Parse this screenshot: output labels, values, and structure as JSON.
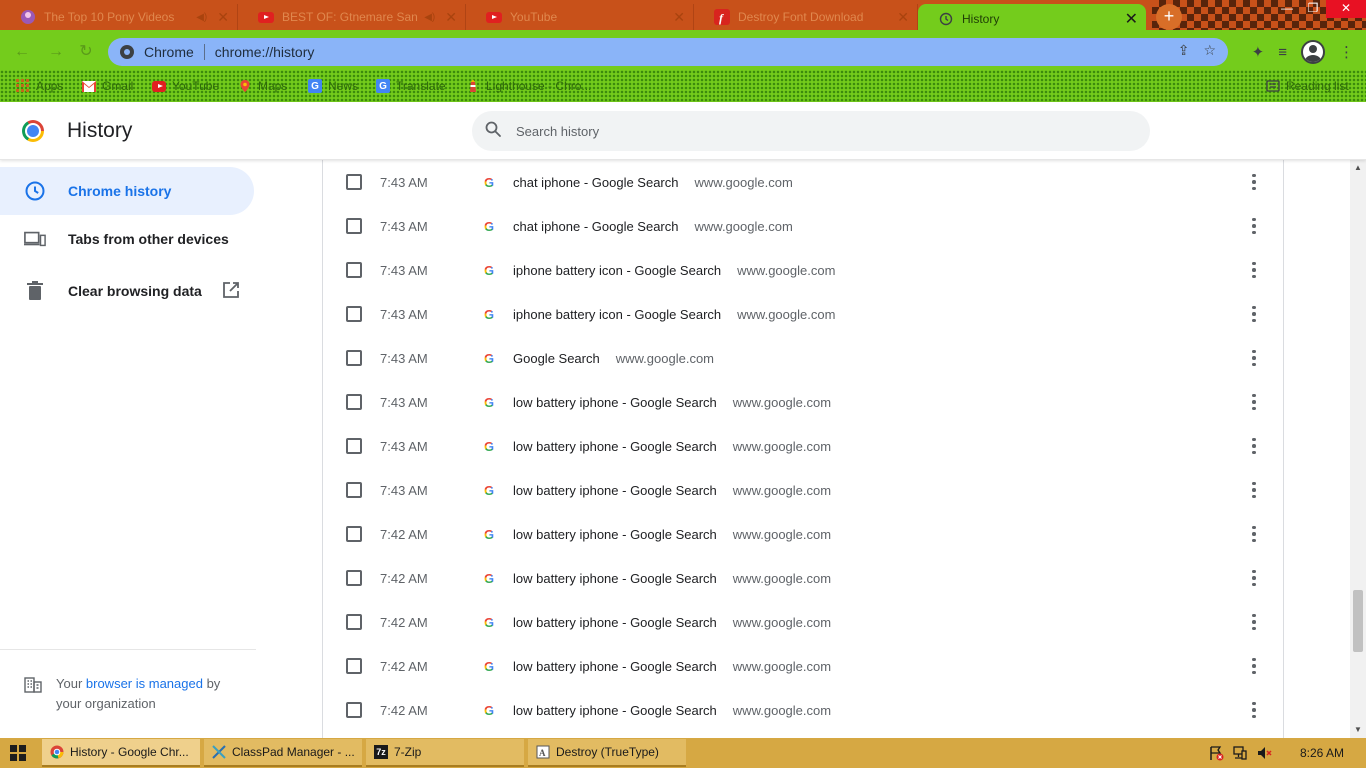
{
  "tabs": [
    {
      "label": "The Top 10 Pony Videos",
      "icon": "pony-avatar-icon",
      "sound": true,
      "active": false
    },
    {
      "label": "BEST OF: Gtnemare Sans !!",
      "icon": "youtube-icon",
      "sound": true,
      "active": false
    },
    {
      "label": "YouTube",
      "icon": "youtube-icon",
      "sound": false,
      "active": false
    },
    {
      "label": "Destroy Font Download",
      "icon": "font-site-icon",
      "sound": false,
      "active": false
    },
    {
      "label": "History",
      "icon": "history-icon",
      "sound": false,
      "active": true
    }
  ],
  "omnibox": {
    "site_label": "Chrome",
    "url": "chrome://history"
  },
  "bookmarks": [
    {
      "label": "Apps",
      "icon": "apps-grid-icon",
      "color": "#c06a1a"
    },
    {
      "label": "Gmail",
      "icon": "gmail-icon",
      "color": "#ea4335"
    },
    {
      "label": "YouTube",
      "icon": "youtube-icon",
      "color": "#e02020"
    },
    {
      "label": "Maps",
      "icon": "maps-icon",
      "color": "#34a853"
    },
    {
      "label": "News",
      "icon": "news-icon",
      "color": "#4285f4"
    },
    {
      "label": "Translate",
      "icon": "translate-icon",
      "color": "#4285f4"
    },
    {
      "label": "Lighthouse - Chro...",
      "icon": "lighthouse-icon",
      "color": "#db4437"
    }
  ],
  "reading_list": "Reading list",
  "header": {
    "title": "History",
    "search_placeholder": "Search history"
  },
  "sidebar": {
    "items": [
      {
        "label": "Chrome history",
        "icon": "clock-icon",
        "active": true
      },
      {
        "label": "Tabs from other devices",
        "icon": "devices-icon",
        "active": false
      },
      {
        "label": "Clear browsing data",
        "icon": "trash-icon",
        "active": false
      }
    ],
    "managed": {
      "prefix": "Your ",
      "link": "browser is managed",
      "suffix": " by your organization"
    }
  },
  "history_rows": [
    {
      "time": "7:43 AM",
      "title": "chat iphone - Google Search",
      "domain": "www.google.com"
    },
    {
      "time": "7:43 AM",
      "title": "chat iphone - Google Search",
      "domain": "www.google.com"
    },
    {
      "time": "7:43 AM",
      "title": "iphone battery icon - Google Search",
      "domain": "www.google.com"
    },
    {
      "time": "7:43 AM",
      "title": "iphone battery icon - Google Search",
      "domain": "www.google.com"
    },
    {
      "time": "7:43 AM",
      "title": "Google Search",
      "domain": "www.google.com"
    },
    {
      "time": "7:43 AM",
      "title": "low battery iphone - Google Search",
      "domain": "www.google.com"
    },
    {
      "time": "7:43 AM",
      "title": "low battery iphone - Google Search",
      "domain": "www.google.com"
    },
    {
      "time": "7:43 AM",
      "title": "low battery iphone - Google Search",
      "domain": "www.google.com"
    },
    {
      "time": "7:42 AM",
      "title": "low battery iphone - Google Search",
      "domain": "www.google.com"
    },
    {
      "time": "7:42 AM",
      "title": "low battery iphone - Google Search",
      "domain": "www.google.com"
    },
    {
      "time": "7:42 AM",
      "title": "low battery iphone - Google Search",
      "domain": "www.google.com"
    },
    {
      "time": "7:42 AM",
      "title": "low battery iphone - Google Search",
      "domain": "www.google.com"
    },
    {
      "time": "7:42 AM",
      "title": "low battery iphone - Google Search",
      "domain": "www.google.com"
    }
  ],
  "taskbar": {
    "items": [
      {
        "label": "History - Google Chr...",
        "icon": "chrome-icon",
        "active": true
      },
      {
        "label": "ClassPad Manager - ...",
        "icon": "classpad-icon",
        "active": false
      },
      {
        "label": "7-Zip",
        "icon": "7zip-icon",
        "active": false
      },
      {
        "label": "Destroy (TrueType)",
        "icon": "font-viewer-icon",
        "active": false
      }
    ],
    "clock": "8:26 AM"
  },
  "colors": {
    "accent": "#1a73e8",
    "tab_strip": "#c8511a",
    "theme_green": "#74cc1c",
    "taskbar": "#d6a843"
  }
}
